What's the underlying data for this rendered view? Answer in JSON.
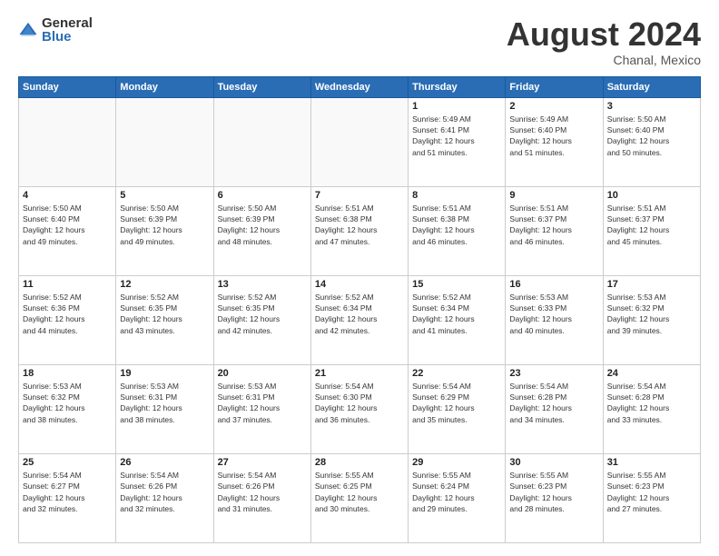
{
  "logo": {
    "general": "General",
    "blue": "Blue"
  },
  "title": "August 2024",
  "subtitle": "Chanal, Mexico",
  "headers": [
    "Sunday",
    "Monday",
    "Tuesday",
    "Wednesday",
    "Thursday",
    "Friday",
    "Saturday"
  ],
  "weeks": [
    [
      {
        "day": "",
        "info": ""
      },
      {
        "day": "",
        "info": ""
      },
      {
        "day": "",
        "info": ""
      },
      {
        "day": "",
        "info": ""
      },
      {
        "day": "1",
        "info": "Sunrise: 5:49 AM\nSunset: 6:41 PM\nDaylight: 12 hours\nand 51 minutes."
      },
      {
        "day": "2",
        "info": "Sunrise: 5:49 AM\nSunset: 6:40 PM\nDaylight: 12 hours\nand 51 minutes."
      },
      {
        "day": "3",
        "info": "Sunrise: 5:50 AM\nSunset: 6:40 PM\nDaylight: 12 hours\nand 50 minutes."
      }
    ],
    [
      {
        "day": "4",
        "info": "Sunrise: 5:50 AM\nSunset: 6:40 PM\nDaylight: 12 hours\nand 49 minutes."
      },
      {
        "day": "5",
        "info": "Sunrise: 5:50 AM\nSunset: 6:39 PM\nDaylight: 12 hours\nand 49 minutes."
      },
      {
        "day": "6",
        "info": "Sunrise: 5:50 AM\nSunset: 6:39 PM\nDaylight: 12 hours\nand 48 minutes."
      },
      {
        "day": "7",
        "info": "Sunrise: 5:51 AM\nSunset: 6:38 PM\nDaylight: 12 hours\nand 47 minutes."
      },
      {
        "day": "8",
        "info": "Sunrise: 5:51 AM\nSunset: 6:38 PM\nDaylight: 12 hours\nand 46 minutes."
      },
      {
        "day": "9",
        "info": "Sunrise: 5:51 AM\nSunset: 6:37 PM\nDaylight: 12 hours\nand 46 minutes."
      },
      {
        "day": "10",
        "info": "Sunrise: 5:51 AM\nSunset: 6:37 PM\nDaylight: 12 hours\nand 45 minutes."
      }
    ],
    [
      {
        "day": "11",
        "info": "Sunrise: 5:52 AM\nSunset: 6:36 PM\nDaylight: 12 hours\nand 44 minutes."
      },
      {
        "day": "12",
        "info": "Sunrise: 5:52 AM\nSunset: 6:35 PM\nDaylight: 12 hours\nand 43 minutes."
      },
      {
        "day": "13",
        "info": "Sunrise: 5:52 AM\nSunset: 6:35 PM\nDaylight: 12 hours\nand 42 minutes."
      },
      {
        "day": "14",
        "info": "Sunrise: 5:52 AM\nSunset: 6:34 PM\nDaylight: 12 hours\nand 42 minutes."
      },
      {
        "day": "15",
        "info": "Sunrise: 5:52 AM\nSunset: 6:34 PM\nDaylight: 12 hours\nand 41 minutes."
      },
      {
        "day": "16",
        "info": "Sunrise: 5:53 AM\nSunset: 6:33 PM\nDaylight: 12 hours\nand 40 minutes."
      },
      {
        "day": "17",
        "info": "Sunrise: 5:53 AM\nSunset: 6:32 PM\nDaylight: 12 hours\nand 39 minutes."
      }
    ],
    [
      {
        "day": "18",
        "info": "Sunrise: 5:53 AM\nSunset: 6:32 PM\nDaylight: 12 hours\nand 38 minutes."
      },
      {
        "day": "19",
        "info": "Sunrise: 5:53 AM\nSunset: 6:31 PM\nDaylight: 12 hours\nand 38 minutes."
      },
      {
        "day": "20",
        "info": "Sunrise: 5:53 AM\nSunset: 6:31 PM\nDaylight: 12 hours\nand 37 minutes."
      },
      {
        "day": "21",
        "info": "Sunrise: 5:54 AM\nSunset: 6:30 PM\nDaylight: 12 hours\nand 36 minutes."
      },
      {
        "day": "22",
        "info": "Sunrise: 5:54 AM\nSunset: 6:29 PM\nDaylight: 12 hours\nand 35 minutes."
      },
      {
        "day": "23",
        "info": "Sunrise: 5:54 AM\nSunset: 6:28 PM\nDaylight: 12 hours\nand 34 minutes."
      },
      {
        "day": "24",
        "info": "Sunrise: 5:54 AM\nSunset: 6:28 PM\nDaylight: 12 hours\nand 33 minutes."
      }
    ],
    [
      {
        "day": "25",
        "info": "Sunrise: 5:54 AM\nSunset: 6:27 PM\nDaylight: 12 hours\nand 32 minutes."
      },
      {
        "day": "26",
        "info": "Sunrise: 5:54 AM\nSunset: 6:26 PM\nDaylight: 12 hours\nand 32 minutes."
      },
      {
        "day": "27",
        "info": "Sunrise: 5:54 AM\nSunset: 6:26 PM\nDaylight: 12 hours\nand 31 minutes."
      },
      {
        "day": "28",
        "info": "Sunrise: 5:55 AM\nSunset: 6:25 PM\nDaylight: 12 hours\nand 30 minutes."
      },
      {
        "day": "29",
        "info": "Sunrise: 5:55 AM\nSunset: 6:24 PM\nDaylight: 12 hours\nand 29 minutes."
      },
      {
        "day": "30",
        "info": "Sunrise: 5:55 AM\nSunset: 6:23 PM\nDaylight: 12 hours\nand 28 minutes."
      },
      {
        "day": "31",
        "info": "Sunrise: 5:55 AM\nSunset: 6:23 PM\nDaylight: 12 hours\nand 27 minutes."
      }
    ]
  ]
}
